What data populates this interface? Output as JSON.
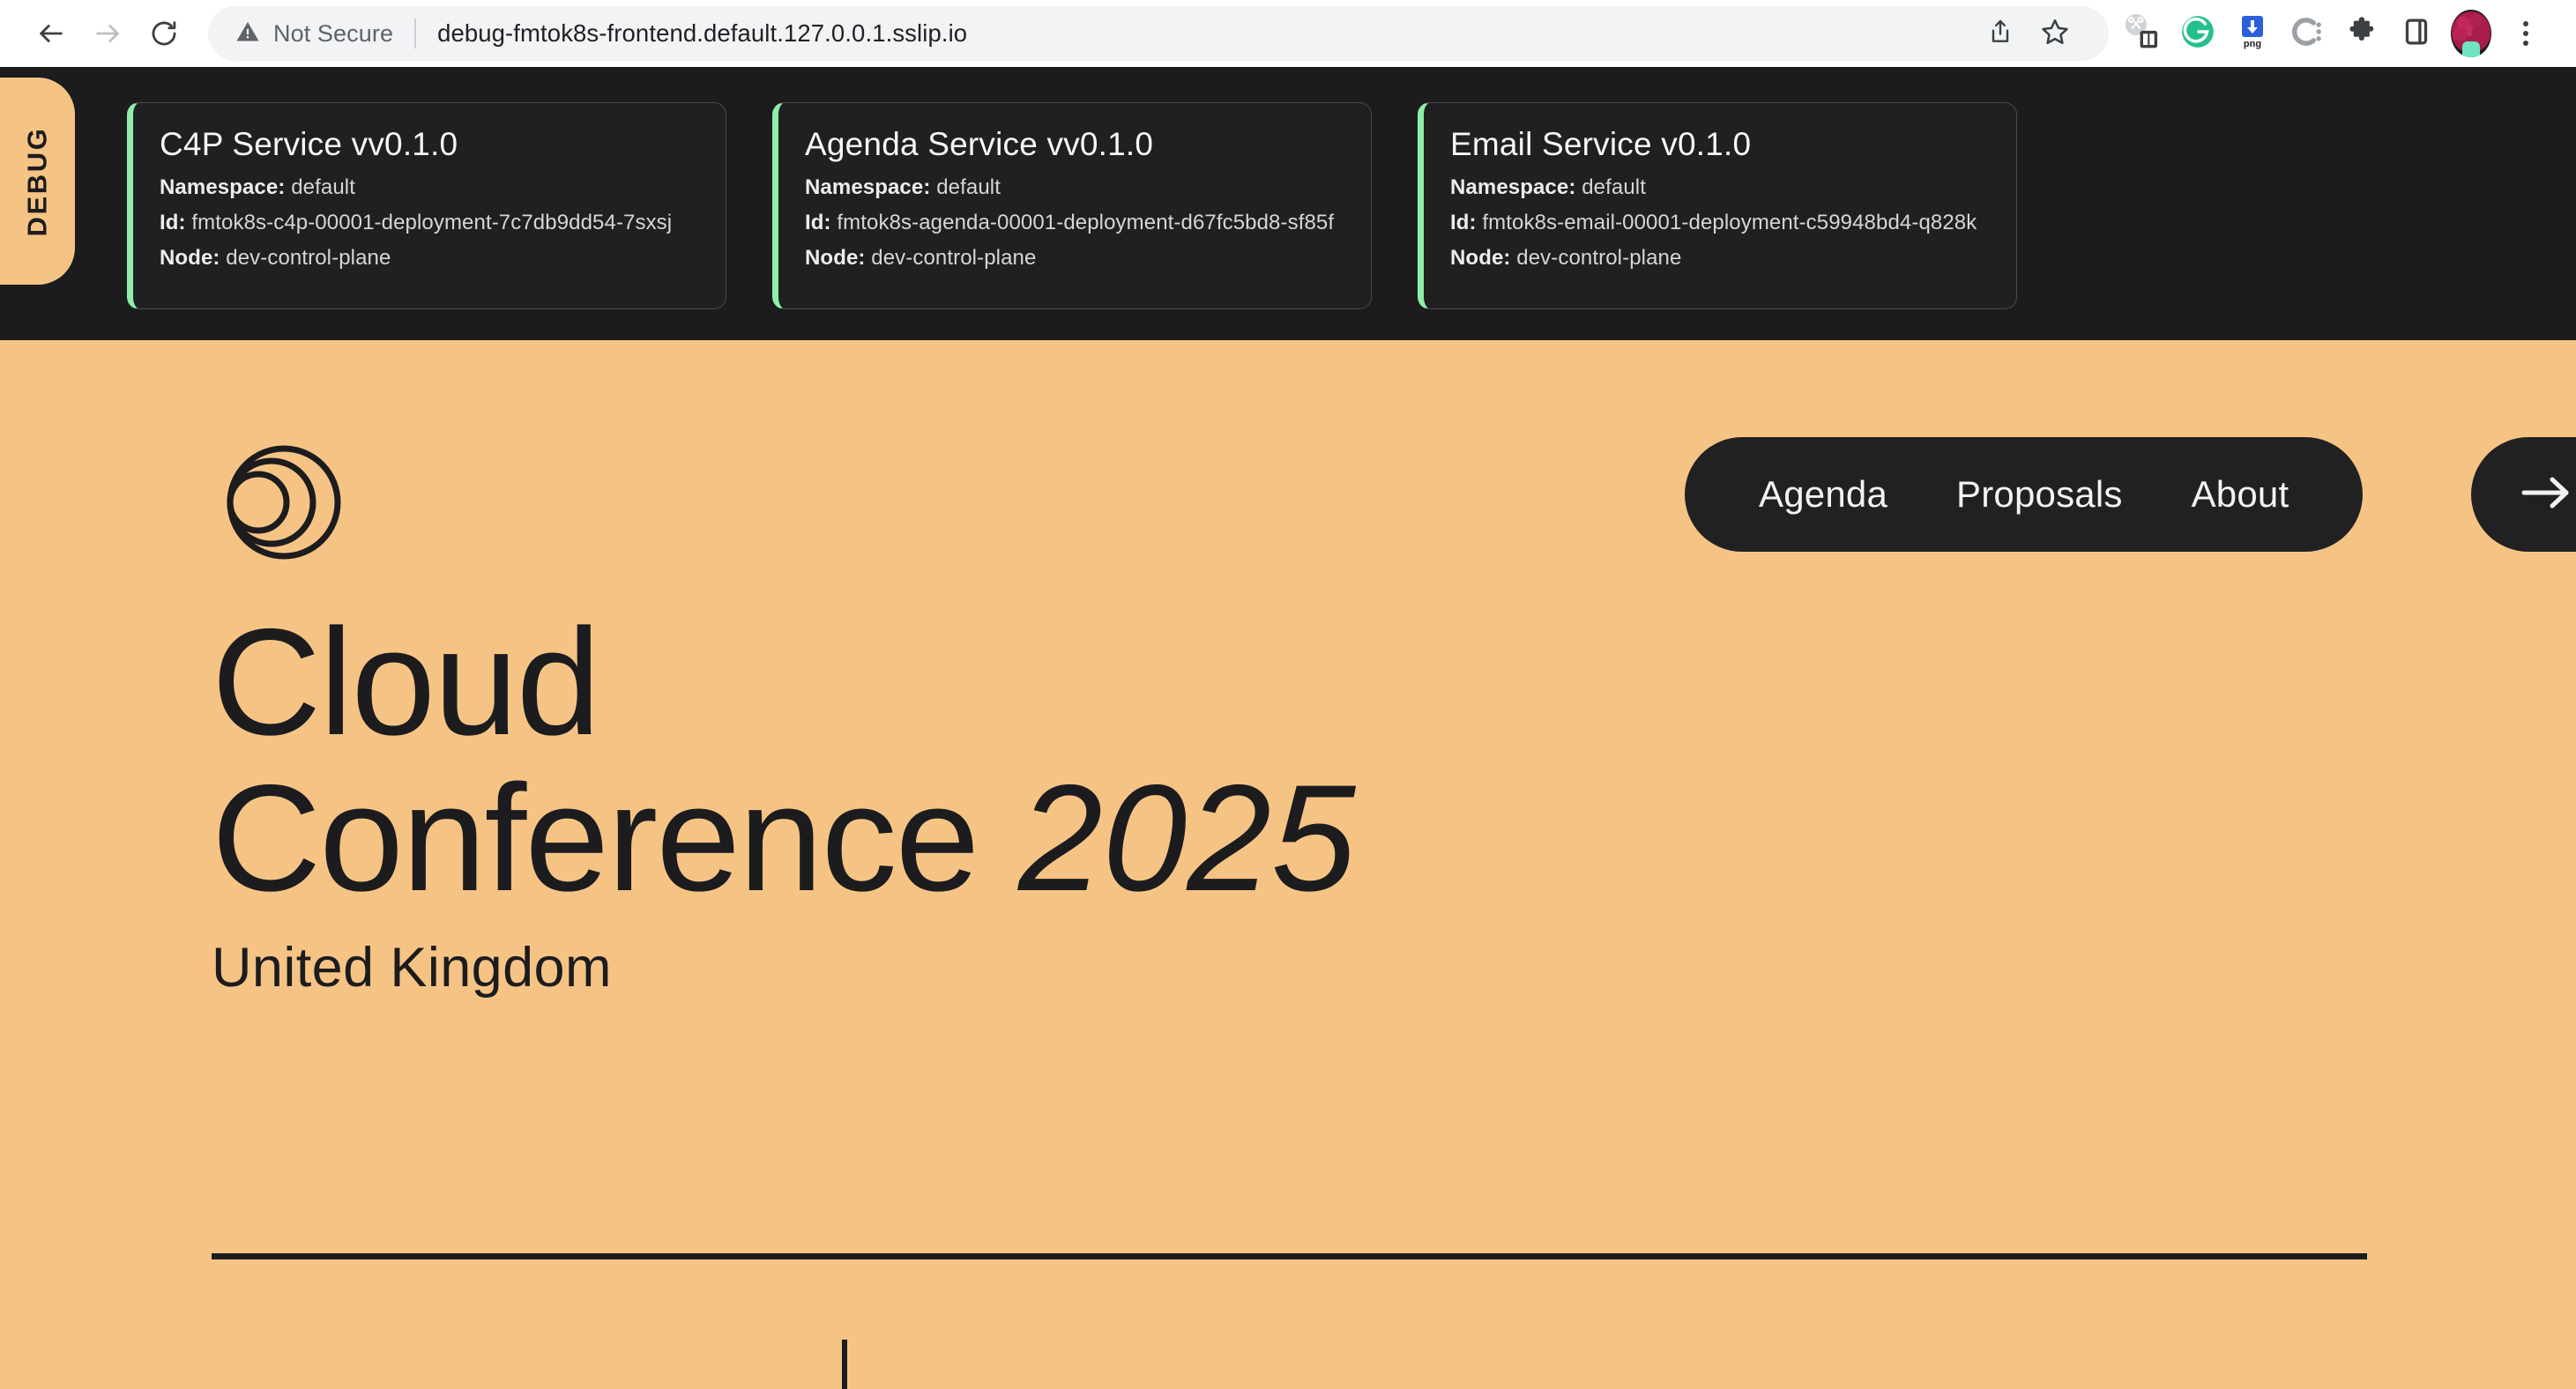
{
  "browser": {
    "back_icon": "back-arrow-icon",
    "forward_icon": "forward-arrow-icon",
    "reload_icon": "reload-icon",
    "security_label": "Not Secure",
    "url": "debug-fmtok8s-frontend.default.127.0.0.1.sslip.io",
    "toolbar_icons": [
      "share-icon",
      "bookmark-star-icon",
      "split-screen-extension-icon",
      "grammarly-extension-icon",
      "png-download-extension-icon",
      "c-extension-icon",
      "puzzle-extensions-icon",
      "side-panel-icon",
      "profile-avatar-icon",
      "chrome-menu-kebab-icon"
    ]
  },
  "debug": {
    "tab_label": "DEBUG",
    "accent_color": "#8feea8",
    "panel_color": "#1c1c1e",
    "cards": [
      {
        "title": "C4P Service vv0.1.0",
        "namespace_label": "Namespace:",
        "namespace_value": "default",
        "id_label": "Id:",
        "id_value": "fmtok8s-c4p-00001-deployment-7c7db9dd54-7sxsj",
        "node_label": "Node:",
        "node_value": "dev-control-plane"
      },
      {
        "title": "Agenda Service vv0.1.0",
        "namespace_label": "Namespace:",
        "namespace_value": "default",
        "id_label": "Id:",
        "id_value": "fmtok8s-agenda-00001-deployment-d67fc5bd8-sf85f",
        "node_label": "Node:",
        "node_value": "dev-control-plane"
      },
      {
        "title": "Email Service v0.1.0",
        "namespace_label": "Namespace:",
        "namespace_value": "default",
        "id_label": "Id:",
        "id_value": "fmtok8s-email-00001-deployment-c59948bd4-q828k",
        "node_label": "Node:",
        "node_value": "dev-control-plane"
      }
    ]
  },
  "site": {
    "background_color": "#f5c485",
    "ink_color": "#1c1c1e",
    "logo_icon": "nested-circles-logo-icon",
    "nav": [
      {
        "label": "Agenda"
      },
      {
        "label": "Proposals"
      },
      {
        "label": "About"
      }
    ],
    "cta_icon": "arrow-right-icon",
    "hero": {
      "line1": "Cloud",
      "line2_main": "Conference",
      "line2_year": "2025",
      "subtitle": "United Kingdom"
    }
  }
}
